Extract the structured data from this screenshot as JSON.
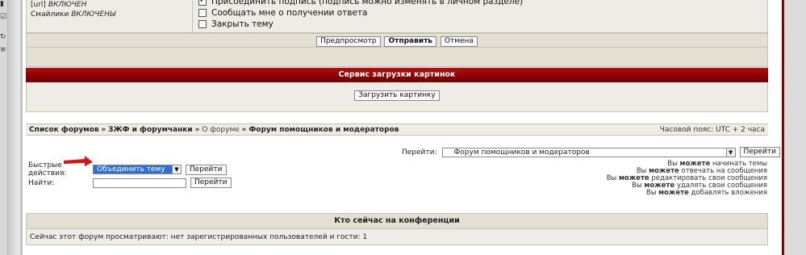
{
  "sidebar_icons": [
    "bookmark-icon",
    "checkbox-icon",
    "refresh-icon",
    "menu-icon"
  ],
  "options": {
    "url_label": "[url]",
    "url_state": "ВКЛЮЧЕН",
    "smilies_label": "Смайлики",
    "smilies_state": "ВКЛЮЧЕНЫ",
    "attach_signature": "Присоединить подпись (подпись можно изменять в личном разделе)",
    "notify_reply": "Сообщать мне о получении ответа",
    "lock_topic": "Закрыть тему"
  },
  "submit": {
    "preview": "Предпросмотр",
    "send": "Отправить",
    "cancel": "Отмена"
  },
  "upload": {
    "title": "Сервис загрузки картинок",
    "button": "Загрузить картинку"
  },
  "breadcrumb": {
    "item1": "Список форумов",
    "item2": "ЗЖФ и форумчанки",
    "item3": "О форуме",
    "item4": "Форум помощников и модераторов",
    "sep": "»",
    "timezone": "Часовой пояс: UTC + 2 часа"
  },
  "jump": {
    "label": "Перейти:",
    "selected": "Форум помощников и модераторов",
    "button": "Перейти"
  },
  "quick_actions": {
    "label": "Быстрые действия:",
    "selected": "Объединить тему",
    "button": "Перейти"
  },
  "find": {
    "label": "Найти:",
    "value": "",
    "button": "Перейти"
  },
  "permissions": {
    "can": "можете",
    "you": "Вы",
    "p1": "начинать темы",
    "p2": "отвечать на сообщения",
    "p3": "редактировать свои сообщения",
    "p4": "удалять свои сообщения",
    "p5": "добавлять вложения"
  },
  "who_online": {
    "title": "Кто сейчас на конференции",
    "text": "Сейчас этот форум просматривают: нет зарегистрированных пользователей и гости: 1"
  },
  "colors": {
    "header_red": "#8b0000",
    "panel_beige": "#efece6",
    "select_highlight": "#2f6fd6",
    "arrow_red": "#d81414"
  }
}
